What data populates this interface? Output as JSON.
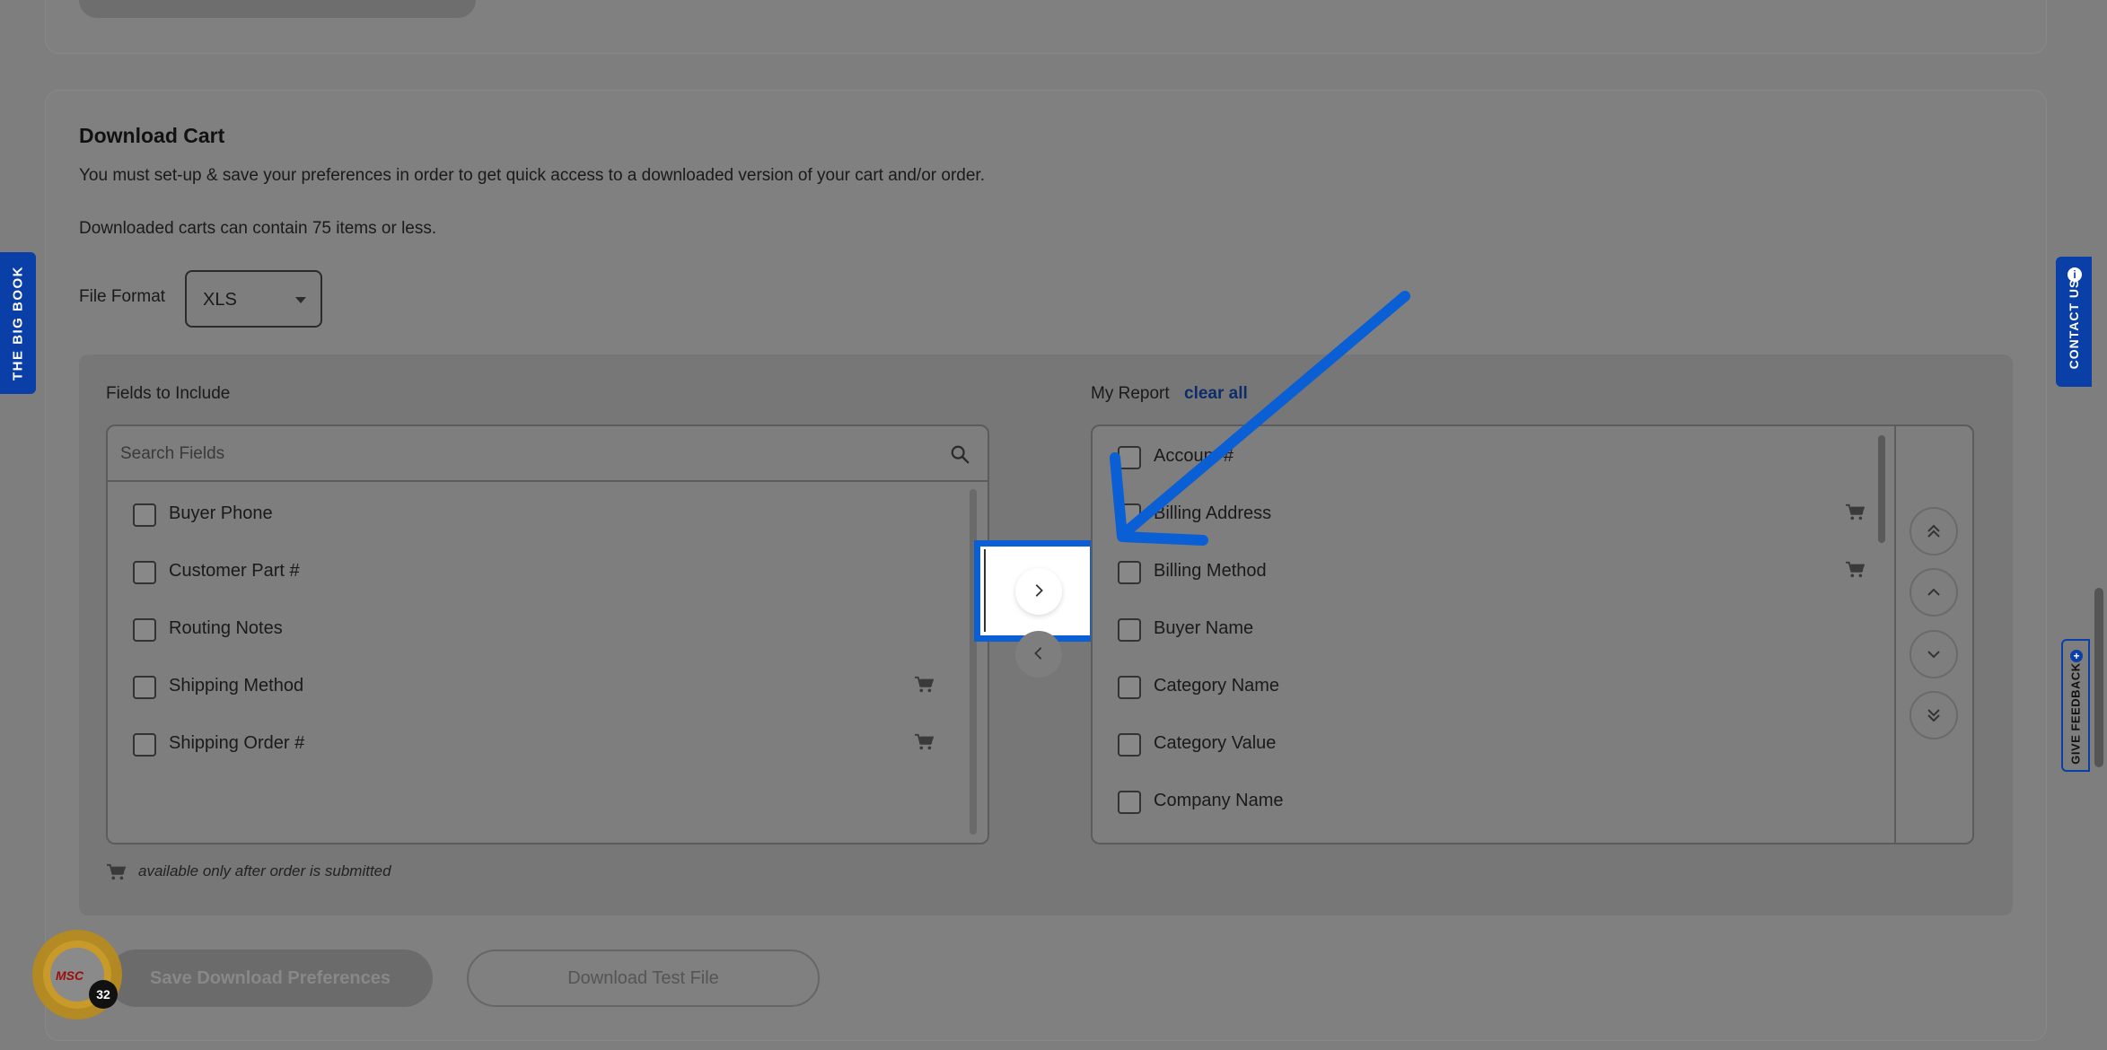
{
  "section": {
    "title": "Download Cart",
    "description_1": "You must set-up & save your preferences in order to get quick access to a downloaded version of your cart and/or order.",
    "description_2": "Downloaded carts can contain 75 items or less."
  },
  "file_format": {
    "label": "File Format",
    "selected": "XLS"
  },
  "fields_to_include": {
    "label": "Fields to Include",
    "search_placeholder": "Search Fields",
    "items": [
      {
        "label": "Buyer Phone",
        "cart_icon": false
      },
      {
        "label": "Customer Part #",
        "cart_icon": false
      },
      {
        "label": "Routing Notes",
        "cart_icon": false
      },
      {
        "label": "Shipping Method",
        "cart_icon": true
      },
      {
        "label": "Shipping Order #",
        "cart_icon": true
      }
    ]
  },
  "my_report": {
    "label": "My Report",
    "clear_all": "clear all",
    "items": [
      {
        "label": "Account #",
        "cart_icon": false
      },
      {
        "label": "Billing Address",
        "cart_icon": true
      },
      {
        "label": "Billing Method",
        "cart_icon": true
      },
      {
        "label": "Buyer Name",
        "cart_icon": false
      },
      {
        "label": "Category Name",
        "cart_icon": false
      },
      {
        "label": "Category Value",
        "cart_icon": false
      },
      {
        "label": "Company Name",
        "cart_icon": false
      }
    ]
  },
  "cart_note": "available only after order is submitted",
  "buttons": {
    "save": "Save Download Preferences",
    "test": "Download Test File"
  },
  "side_tabs": {
    "big_book": "THE BIG BOOK",
    "contact_us": "CONTACT US",
    "feedback": "GIVE FEEDBACK"
  },
  "msc_badge": {
    "logo_text": "MSC",
    "count": "32"
  },
  "colors": {
    "accent": "#0a5fd4",
    "brand_blue": "#0b3fa8",
    "link": "#0e2c6a"
  }
}
